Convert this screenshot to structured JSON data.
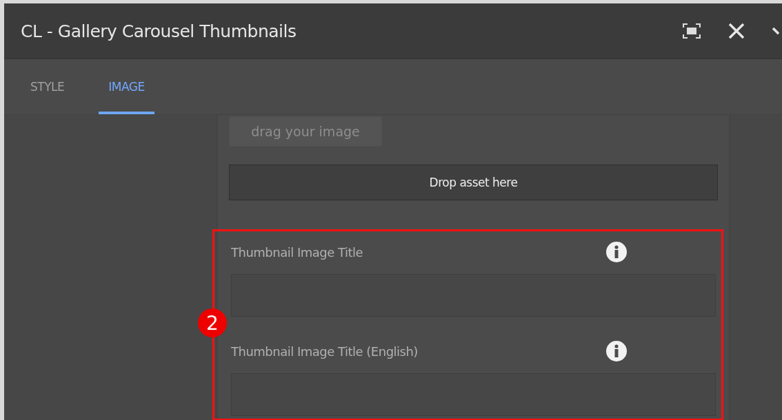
{
  "window": {
    "title": "CL - Gallery Carousel Thumbnails"
  },
  "tabs": [
    {
      "label": "STYLE",
      "selected": false
    },
    {
      "label": "IMAGE",
      "selected": true
    }
  ],
  "image_panel": {
    "upload_button": {
      "label": "drag your image",
      "disabled": true
    },
    "drop_zone": "Drop asset here"
  },
  "annotation": {
    "marker": "2"
  },
  "fields": [
    {
      "label": "Thumbnail Image Title"
    },
    {
      "label": "Thumbnail Image Title (English)"
    }
  ]
}
